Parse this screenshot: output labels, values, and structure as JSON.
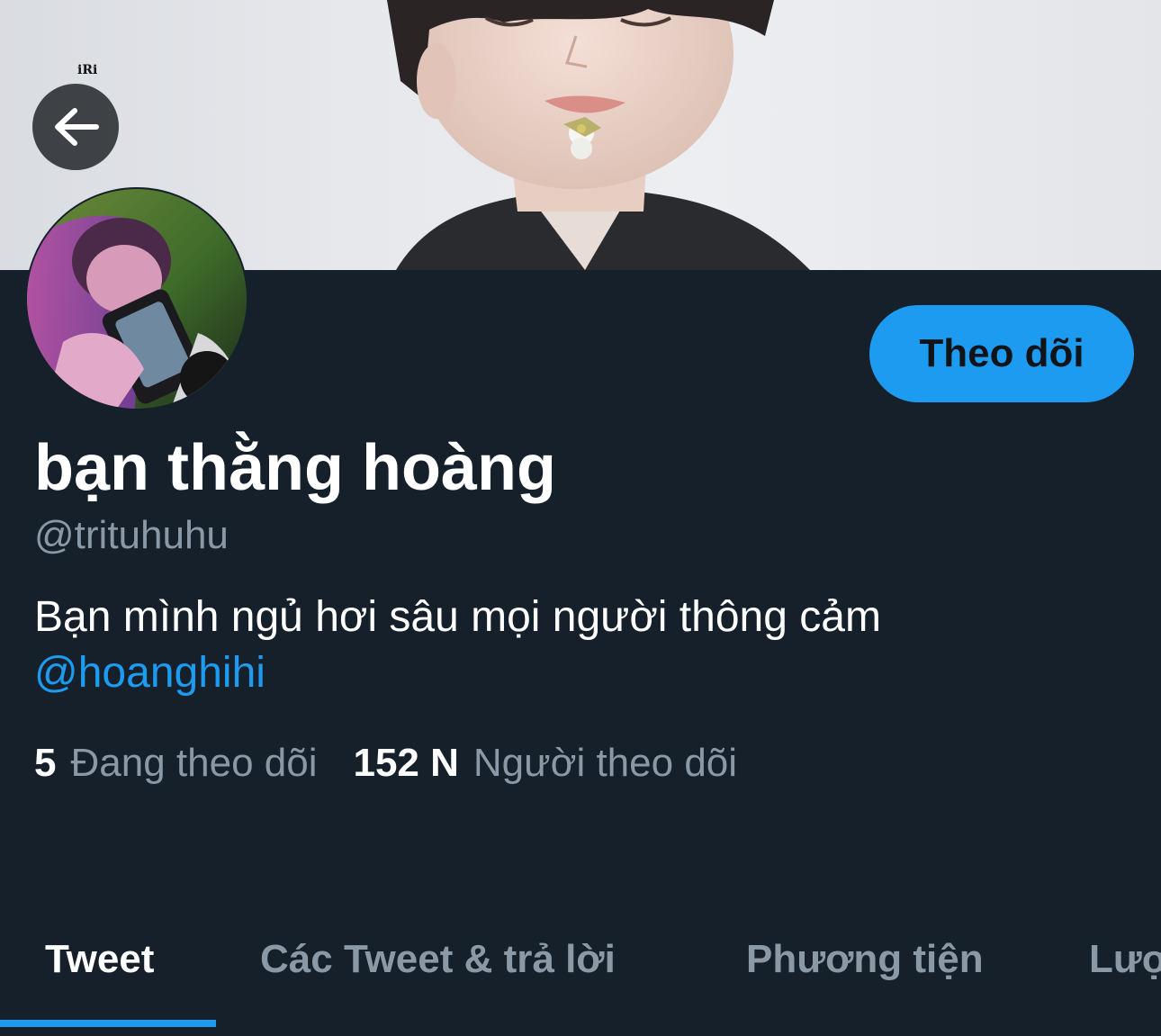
{
  "banner": {
    "watermark": "iRi"
  },
  "profile": {
    "display_name": "bạn thằng hoàng",
    "handle": "@trituhuhu",
    "bio_text": "Bạn mình ngủ hơi sâu mọi người thông cảm",
    "bio_mention": "@hoanghihi"
  },
  "actions": {
    "follow_label": "Theo dõi"
  },
  "stats": {
    "following_count": "5",
    "following_label": "Đang theo dõi",
    "followers_count": "152 N",
    "followers_label": "Người theo dõi"
  },
  "tabs": [
    {
      "label": "Tweet",
      "active": true
    },
    {
      "label": "Các Tweet & trả lời",
      "active": false
    },
    {
      "label": "Phương tiện",
      "active": false
    },
    {
      "label": "Lượt thích",
      "active": false
    }
  ],
  "colors": {
    "background": "#15202b",
    "accent": "#1d9bf0",
    "secondary_text": "#8b98a5",
    "primary_text": "#ffffff"
  },
  "icons": {
    "back": "arrow-left-icon"
  }
}
